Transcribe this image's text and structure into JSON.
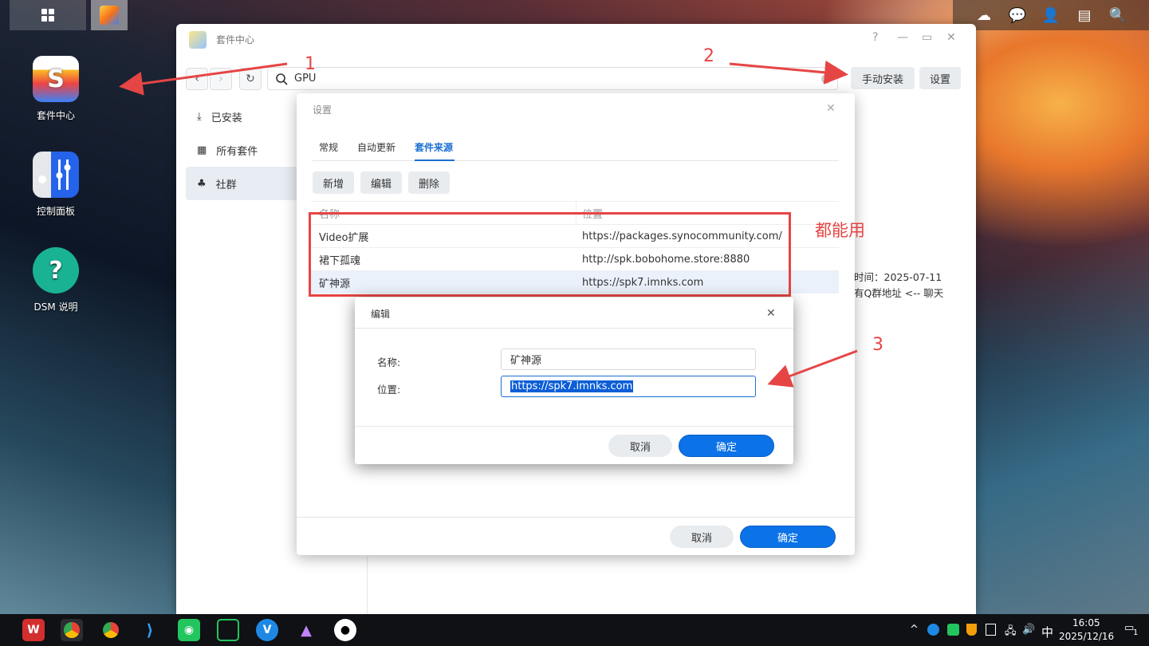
{
  "desktop": {
    "icons": [
      {
        "label": "套件中心",
        "icon": "package-center-icon",
        "color": "#f5a623"
      },
      {
        "label": "控制面板",
        "icon": "control-panel-icon",
        "color": "#2a6ee8"
      },
      {
        "label": "DSM 说明",
        "icon": "help-icon",
        "color": "#19b394",
        "glyph": "?"
      }
    ]
  },
  "window": {
    "title": "套件中心",
    "help": "?",
    "minimize": "—",
    "maximize": "▭",
    "close": "✕",
    "search_value": "GPU",
    "manual_install": "手动安装",
    "settings": "设置",
    "sidebar": [
      {
        "label": "已安装",
        "icon": "download-icon"
      },
      {
        "label": "所有套件",
        "icon": "grid-icon"
      },
      {
        "label": "社群",
        "icon": "community-icon"
      }
    ],
    "bg_text": {
      "time": "时间：2025-07-11",
      "group": "有Q群地址 <-- 聊天"
    }
  },
  "settings_dialog": {
    "title": "设置",
    "close": "✕",
    "tabs": [
      "常规",
      "自动更新",
      "套件来源"
    ],
    "active_tab": "套件来源",
    "toolbar": [
      "新增",
      "编辑",
      "删除"
    ],
    "columns": [
      "名称",
      "位置"
    ],
    "rows": [
      {
        "name": "Video扩展",
        "location": "https://packages.synocommunity.com/"
      },
      {
        "name": "裙下孤魂",
        "location": "http://spk.bobohome.store:8880"
      },
      {
        "name": "矿神源",
        "location": "https://spk7.imnks.com"
      }
    ],
    "cancel": "取消",
    "ok": "确定"
  },
  "edit_dialog": {
    "title": "编辑",
    "close": "✕",
    "name_label": "名称:",
    "name_value": "矿神源",
    "location_label": "位置:",
    "location_value": "https://spk7.imnks.com",
    "cancel": "取消",
    "ok": "确定"
  },
  "annotations": {
    "one": "1",
    "two": "2",
    "three": "3",
    "all_work": "都能用",
    "color": "#e64545"
  },
  "taskbar": {
    "time": "16:05",
    "date": "2025/12/16",
    "ime": "中",
    "notification_count": "1"
  }
}
